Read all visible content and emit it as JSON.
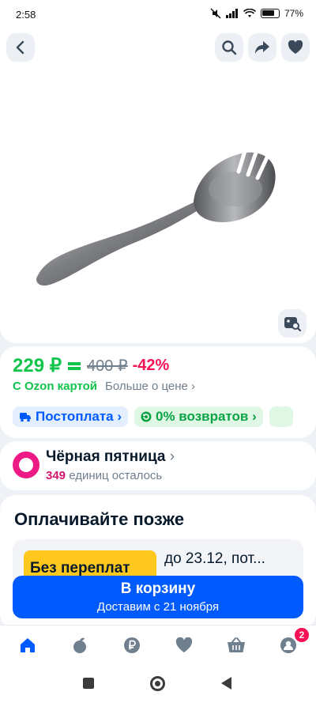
{
  "status_bar": {
    "time": "2:58",
    "battery": "77%"
  },
  "price": {
    "current": "229 ₽",
    "old": "400 ₽",
    "discount": "-42%",
    "ozon_card_label": "С Ozon картой",
    "more_link": "Больше о цене ›"
  },
  "chips": [
    {
      "label": "Постоплата ›"
    },
    {
      "label": "0% возвратов ›"
    }
  ],
  "black_friday": {
    "title": "Чёрная пятница",
    "arrow": "›",
    "count": "349",
    "count_suffix": "единиц осталось"
  },
  "pay_later": {
    "title": "Оплачивайте позже",
    "badge": "Без переплат",
    "text": "до 23.12, пот..."
  },
  "cart_button": {
    "title": "В корзину",
    "subtitle": "Доставим с 21 ноября"
  },
  "tabbar": {
    "items": [
      "home-icon",
      "fresh-icon",
      "finance-icon",
      "favorites-icon",
      "cart-icon",
      "profile-icon"
    ],
    "profile_badge": "2"
  },
  "colors": {
    "accent": "#005bff",
    "price_green": "#10c44c",
    "discount": "#f91155",
    "black_friday": "#ed1a85",
    "badge_yellow": "#ffc81f"
  }
}
